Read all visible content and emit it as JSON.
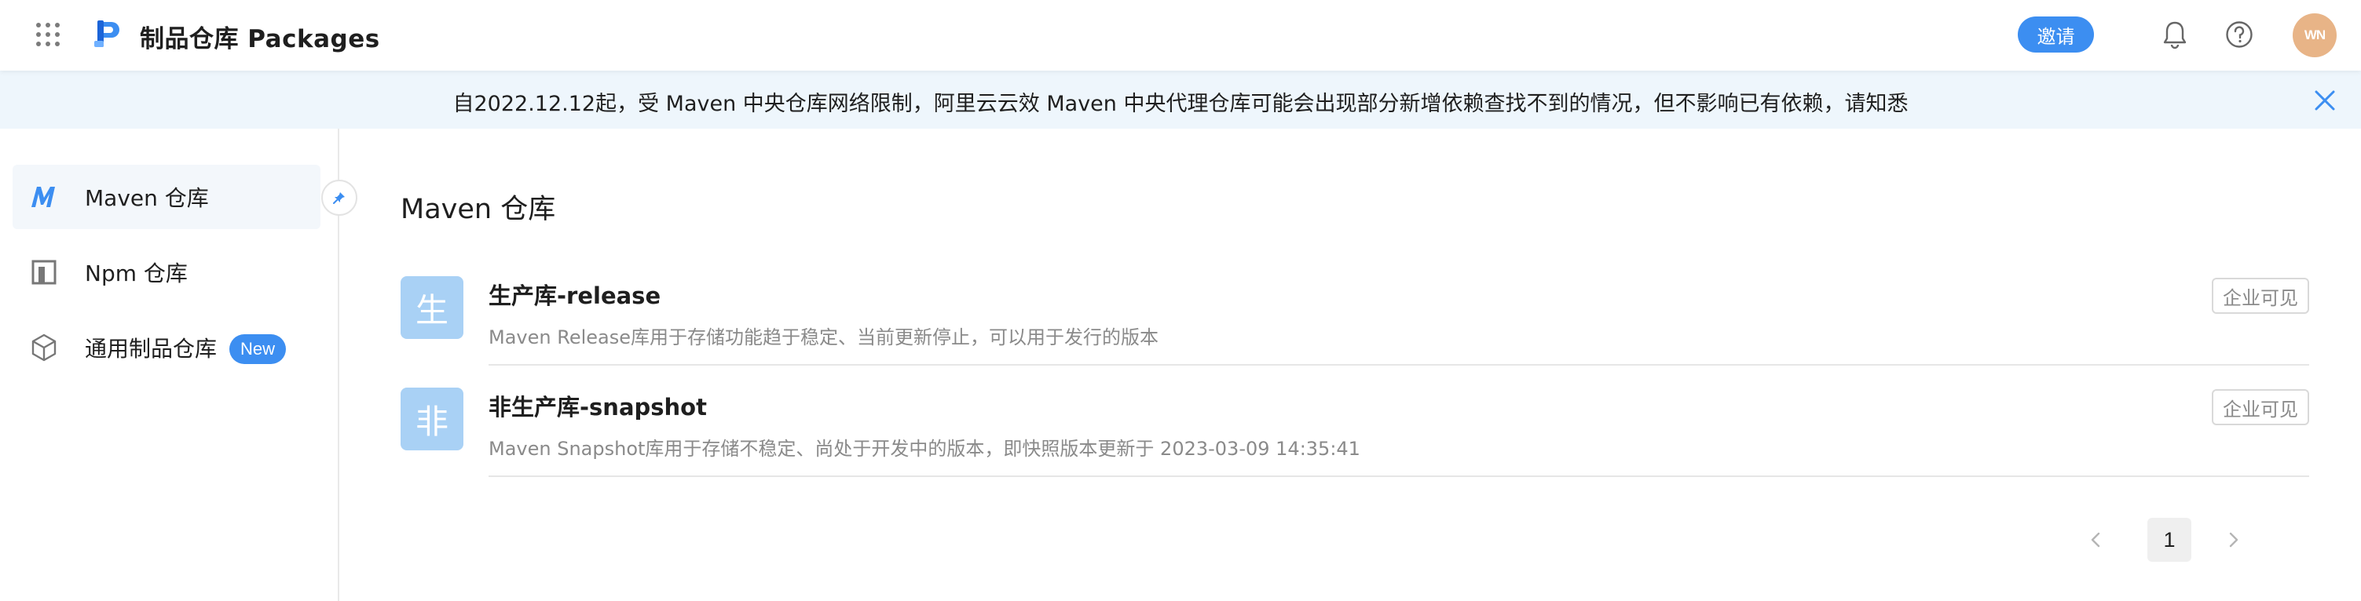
{
  "header": {
    "app_title": "制品仓库 Packages",
    "invite_label": "邀请",
    "avatar_initials": "WN",
    "icons": [
      "apps-grid-icon",
      "logo",
      "bell-icon",
      "help-icon"
    ]
  },
  "notice": {
    "text": "自2022.12.12起，受 Maven 中央仓库网络限制，阿里云云效 Maven 中央代理仓库可能会出现部分新增依赖查找不到的情况，但不影响已有依赖，请知悉",
    "close_icon": "close-icon"
  },
  "sidebar": {
    "items": [
      {
        "label": "Maven 仓库",
        "icon": "maven-icon",
        "active": true
      },
      {
        "label": "Npm 仓库",
        "icon": "npm-icon",
        "active": false
      },
      {
        "label": "通用制品仓库",
        "icon": "package-box-icon",
        "active": false,
        "badge": "New"
      }
    ],
    "pin_icon": "pin-icon"
  },
  "main": {
    "title": "Maven 仓库",
    "repos": [
      {
        "avatar_char": "生",
        "name": "生产库-release",
        "description": "Maven Release库用于存储功能趋于稳定、当前更新停止，可以用于发行的版本",
        "visibility": "企业可见"
      },
      {
        "avatar_char": "非",
        "name": "非生产库-snapshot",
        "description": "Maven Snapshot库用于存储不稳定、尚处于开发中的版本，即快照版本更新于 2023-03-09 14:35:41",
        "visibility": "企业可见"
      }
    ],
    "pagination": {
      "current_page": "1"
    }
  },
  "colors": {
    "accent": "#3c8ef1",
    "notice_bg": "#eef6fc",
    "repo_avatar_bg": "#a9d1f5",
    "user_avatar_bg": "#e8b487"
  }
}
